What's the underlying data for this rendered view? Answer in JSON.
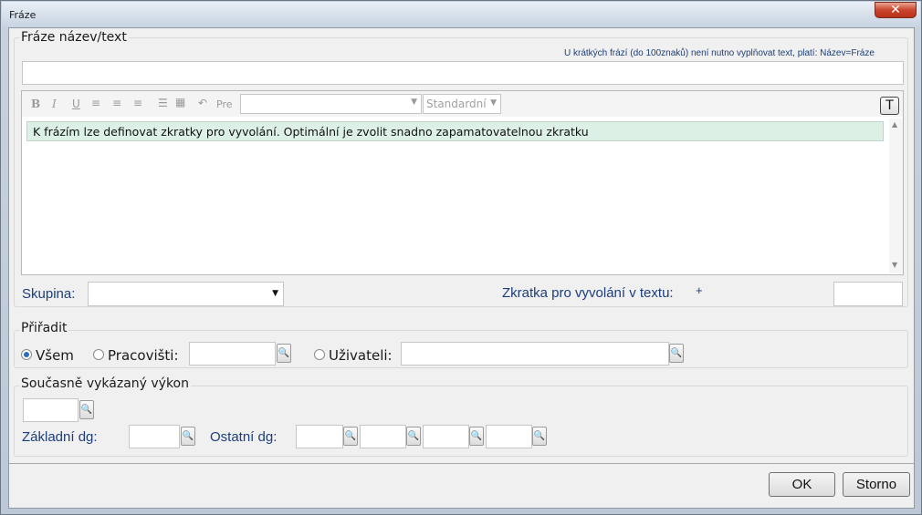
{
  "window": {
    "title": "Fráze",
    "close_glyph": "✕"
  },
  "phrase": {
    "legend": "Fráze název/text",
    "hint": "U krátkých frází (do 100znaků) není nutno vyplňovat text, platí:  Název=Fráze",
    "name_value": ""
  },
  "editor": {
    "toolbar": {
      "bold": "B",
      "italic": "I",
      "underline": "U",
      "pre": "Pre",
      "font_value": "",
      "size_value": "Standardní",
      "text_toggle": "T"
    },
    "content": "K frázím lze definovat zkratky pro vyvolání. Optimální je zvolit snadno zapamatovatelnou zkratku"
  },
  "group": {
    "label": "Skupina:",
    "value": ""
  },
  "shortcut": {
    "label": "Zkratka pro vyvolání v textu:",
    "plus": "+",
    "value": ""
  },
  "assign": {
    "legend": "Přiřadit",
    "all_label": "Všem",
    "workplace_label": "Pracovišti:",
    "user_label": "Uživateli:",
    "selected": "all"
  },
  "performance": {
    "legend": "Současně vykázaný výkon",
    "basic_dg_label": "Základní dg:",
    "other_dg_label": "Ostatní dg:"
  },
  "buttons": {
    "ok": "OK",
    "cancel": "Storno"
  }
}
